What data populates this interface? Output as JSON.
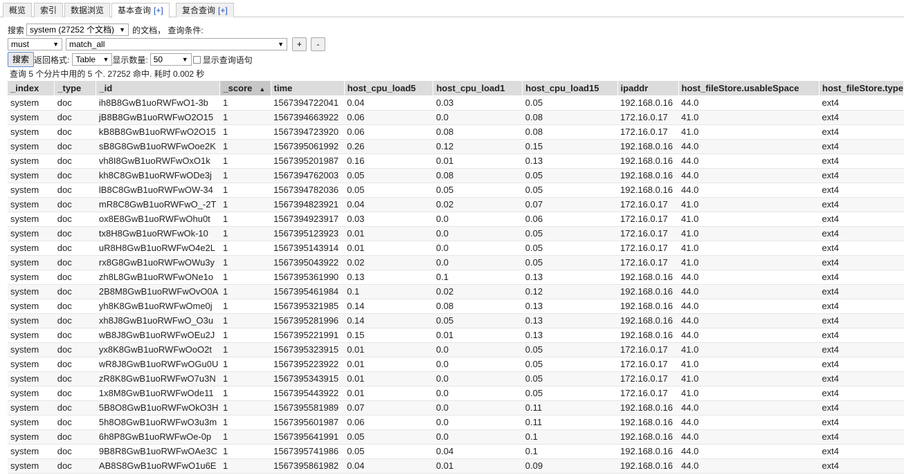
{
  "tabs": [
    {
      "label": "概览",
      "plus": ""
    },
    {
      "label": "索引",
      "plus": ""
    },
    {
      "label": "数据浏览",
      "plus": ""
    },
    {
      "label": "基本查询",
      "plus": "[+]"
    },
    {
      "label": "复合查询",
      "plus": "[+]"
    }
  ],
  "query": {
    "search_label": "搜索",
    "index_select": "system (27252 个文档)",
    "docs_label": "的文档， 查询条件:",
    "bool_select": "must",
    "query_select": "match_all",
    "add_label": "+",
    "remove_label": "-",
    "search_button": "搜索",
    "format_label": "返回格式:",
    "format_select": "Table",
    "size_label": "显示数量:",
    "size_select": "50",
    "show_query_label": "显示查询语句"
  },
  "stats": "查询 5 个分片中用的 5 个. 27252 命中. 耗时 0.002 秒",
  "table": {
    "sort_icon": "▲",
    "columns": [
      "_index",
      "_type",
      "_id",
      "_score",
      "time",
      "host_cpu_load5",
      "host_cpu_load1",
      "host_cpu_load15",
      "ipaddr",
      "host_fileStore.usableSpace",
      "host_fileStore.type"
    ],
    "rows": [
      [
        "system",
        "doc",
        "ih8B8GwB1uoRWFwO1-3b",
        "1",
        "1567394722041",
        "0.04",
        "0.03",
        "0.05",
        "192.168.0.16",
        "44.0",
        "ext4"
      ],
      [
        "system",
        "doc",
        "jB8B8GwB1uoRWFwO2O15",
        "1",
        "1567394663922",
        "0.06",
        "0.0",
        "0.08",
        "172.16.0.17",
        "41.0",
        "ext4"
      ],
      [
        "system",
        "doc",
        "kB8B8GwB1uoRWFwO2O15",
        "1",
        "1567394723920",
        "0.06",
        "0.08",
        "0.08",
        "172.16.0.17",
        "41.0",
        "ext4"
      ],
      [
        "system",
        "doc",
        "sB8G8GwB1uoRWFwOoe2K",
        "1",
        "1567395061992",
        "0.26",
        "0.12",
        "0.15",
        "192.168.0.16",
        "44.0",
        "ext4"
      ],
      [
        "system",
        "doc",
        "vh8I8GwB1uoRWFwOxO1k",
        "1",
        "1567395201987",
        "0.16",
        "0.01",
        "0.13",
        "192.168.0.16",
        "44.0",
        "ext4"
      ],
      [
        "system",
        "doc",
        "kh8C8GwB1uoRWFwODe3j",
        "1",
        "1567394762003",
        "0.05",
        "0.08",
        "0.05",
        "192.168.0.16",
        "44.0",
        "ext4"
      ],
      [
        "system",
        "doc",
        "lB8C8GwB1uoRWFwOW-34",
        "1",
        "1567394782036",
        "0.05",
        "0.05",
        "0.05",
        "192.168.0.16",
        "44.0",
        "ext4"
      ],
      [
        "system",
        "doc",
        "mR8C8GwB1uoRWFwO_-2T",
        "1",
        "1567394823921",
        "0.04",
        "0.02",
        "0.07",
        "172.16.0.17",
        "41.0",
        "ext4"
      ],
      [
        "system",
        "doc",
        "ox8E8GwB1uoRWFwOhu0t",
        "1",
        "1567394923917",
        "0.03",
        "0.0",
        "0.06",
        "172.16.0.17",
        "41.0",
        "ext4"
      ],
      [
        "system",
        "doc",
        "tx8H8GwB1uoRWFwOk-10",
        "1",
        "1567395123923",
        "0.01",
        "0.0",
        "0.05",
        "172.16.0.17",
        "41.0",
        "ext4"
      ],
      [
        "system",
        "doc",
        "uR8H8GwB1uoRWFwO4e2L",
        "1",
        "1567395143914",
        "0.01",
        "0.0",
        "0.05",
        "172.16.0.17",
        "41.0",
        "ext4"
      ],
      [
        "system",
        "doc",
        "rx8G8GwB1uoRWFwOWu3y",
        "1",
        "1567395043922",
        "0.02",
        "0.0",
        "0.05",
        "172.16.0.17",
        "41.0",
        "ext4"
      ],
      [
        "system",
        "doc",
        "zh8L8GwB1uoRWFwONe1o",
        "1",
        "1567395361990",
        "0.13",
        "0.1",
        "0.13",
        "192.168.0.16",
        "44.0",
        "ext4"
      ],
      [
        "system",
        "doc",
        "2B8M8GwB1uoRWFwOvO0A",
        "1",
        "1567395461984",
        "0.1",
        "0.02",
        "0.12",
        "192.168.0.16",
        "44.0",
        "ext4"
      ],
      [
        "system",
        "doc",
        "yh8K8GwB1uoRWFwOme0j",
        "1",
        "1567395321985",
        "0.14",
        "0.08",
        "0.13",
        "192.168.0.16",
        "44.0",
        "ext4"
      ],
      [
        "system",
        "doc",
        "xh8J8GwB1uoRWFwO_O3u",
        "1",
        "1567395281996",
        "0.14",
        "0.05",
        "0.13",
        "192.168.0.16",
        "44.0",
        "ext4"
      ],
      [
        "system",
        "doc",
        "wB8J8GwB1uoRWFwOEu2J",
        "1",
        "1567395221991",
        "0.15",
        "0.01",
        "0.13",
        "192.168.0.16",
        "44.0",
        "ext4"
      ],
      [
        "system",
        "doc",
        "yx8K8GwB1uoRWFwOoO2t",
        "1",
        "1567395323915",
        "0.01",
        "0.0",
        "0.05",
        "172.16.0.17",
        "41.0",
        "ext4"
      ],
      [
        "system",
        "doc",
        "wR8J8GwB1uoRWFwOGu0U",
        "1",
        "1567395223922",
        "0.01",
        "0.0",
        "0.05",
        "172.16.0.17",
        "41.0",
        "ext4"
      ],
      [
        "system",
        "doc",
        "zR8K8GwB1uoRWFwO7u3N",
        "1",
        "1567395343915",
        "0.01",
        "0.0",
        "0.05",
        "172.16.0.17",
        "41.0",
        "ext4"
      ],
      [
        "system",
        "doc",
        "1x8M8GwB1uoRWFwOde11",
        "1",
        "1567395443922",
        "0.01",
        "0.0",
        "0.05",
        "172.16.0.17",
        "41.0",
        "ext4"
      ],
      [
        "system",
        "doc",
        "5B8O8GwB1uoRWFwOkO3H",
        "1",
        "1567395581989",
        "0.07",
        "0.0",
        "0.11",
        "192.168.0.16",
        "44.0",
        "ext4"
      ],
      [
        "system",
        "doc",
        "5h8O8GwB1uoRWFwO3u3m",
        "1",
        "1567395601987",
        "0.06",
        "0.0",
        "0.11",
        "192.168.0.16",
        "44.0",
        "ext4"
      ],
      [
        "system",
        "doc",
        "6h8P8GwB1uoRWFwOe-0p",
        "1",
        "1567395641991",
        "0.05",
        "0.0",
        "0.1",
        "192.168.0.16",
        "44.0",
        "ext4"
      ],
      [
        "system",
        "doc",
        "9B8R8GwB1uoRWFwOAe3C",
        "1",
        "1567395741986",
        "0.05",
        "0.04",
        "0.1",
        "192.168.0.16",
        "44.0",
        "ext4"
      ],
      [
        "system",
        "doc",
        "AB8S8GwB1uoRWFwO1u6E",
        "1",
        "1567395861982",
        "0.04",
        "0.01",
        "0.09",
        "192.168.0.16",
        "44.0",
        "ext4"
      ]
    ]
  }
}
